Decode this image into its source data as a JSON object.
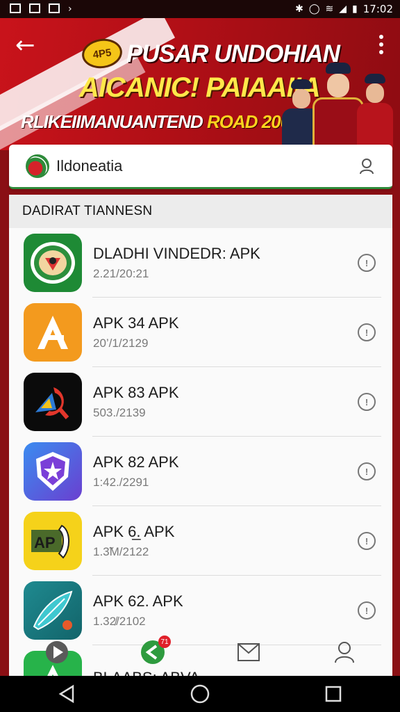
{
  "status_bar": {
    "time": "17:02"
  },
  "banner": {
    "logo_text": "4P5",
    "title": "PUSAR UNDOHIAN",
    "subtitle": "AICANIC! PAIAAIIA",
    "tagline_main": "RLIKEIIMANUANTEND",
    "tagline_highlight": "ROAD 2000"
  },
  "search": {
    "text": "Ildoneatia"
  },
  "section": {
    "title": "DADIRAT TIANNESN"
  },
  "apps": [
    {
      "name": "DLADHI VINDEDR: APK",
      "sub": "2.21/20:21",
      "icon": "emblem-icon",
      "color": "#1e8a35"
    },
    {
      "name": "APK 34 APK",
      "sub": "20’/1/2129",
      "icon": "letter-a-icon",
      "color": "#f39a1e"
    },
    {
      "name": "APK 83 APK",
      "sub": "503./2139",
      "icon": "sickle-icon",
      "color": "#0b0b0b"
    },
    {
      "name": "APK 82 APK",
      "sub": "1:42./2291",
      "icon": "shield-star-icon",
      "color": "#4a4fd8"
    },
    {
      "name": "APK 6̲. APK",
      "sub": "1.3̃M/2122",
      "icon": "ap-badge-icon",
      "color": "#f5d21a"
    },
    {
      "name": "APK 62. APK",
      "sub": "1.32̸/2102",
      "icon": "feather-icon",
      "color": "#1f8a90"
    },
    {
      "name": "BLAABS: ABVA",
      "sub": "",
      "icon": "leaf-icon",
      "color": "#27b34a"
    }
  ],
  "bottom_nav": {
    "badge": "71"
  },
  "colors": {
    "brand_red": "#c9131b",
    "brand_green": "#2e8b3a",
    "accent_yellow": "#ffe84a"
  }
}
